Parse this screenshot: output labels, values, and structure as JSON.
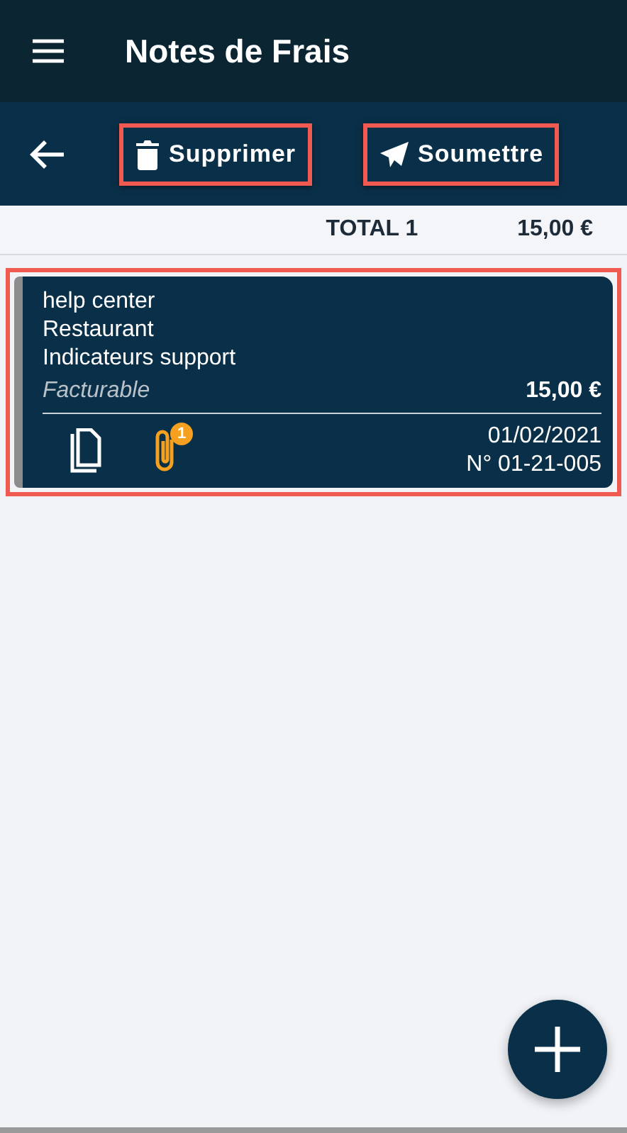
{
  "app_bar": {
    "title": "Notes de Frais"
  },
  "toolbar": {
    "actions": [
      {
        "kind": "delete",
        "label": "Supprimer",
        "highlighted": true
      },
      {
        "kind": "submit",
        "label": "Soumettre",
        "highlighted": true
      }
    ]
  },
  "total": {
    "label": "TOTAL 1",
    "amount": "15,00 €"
  },
  "expenses": [
    {
      "highlighted": true,
      "lines": [
        "help center",
        "Restaurant",
        "Indicateurs support"
      ],
      "billing": "Facturable",
      "amount": "15,00 €",
      "attachments": "1",
      "date": "01/02/2021",
      "number": "N° 01-21-005"
    }
  ]
}
